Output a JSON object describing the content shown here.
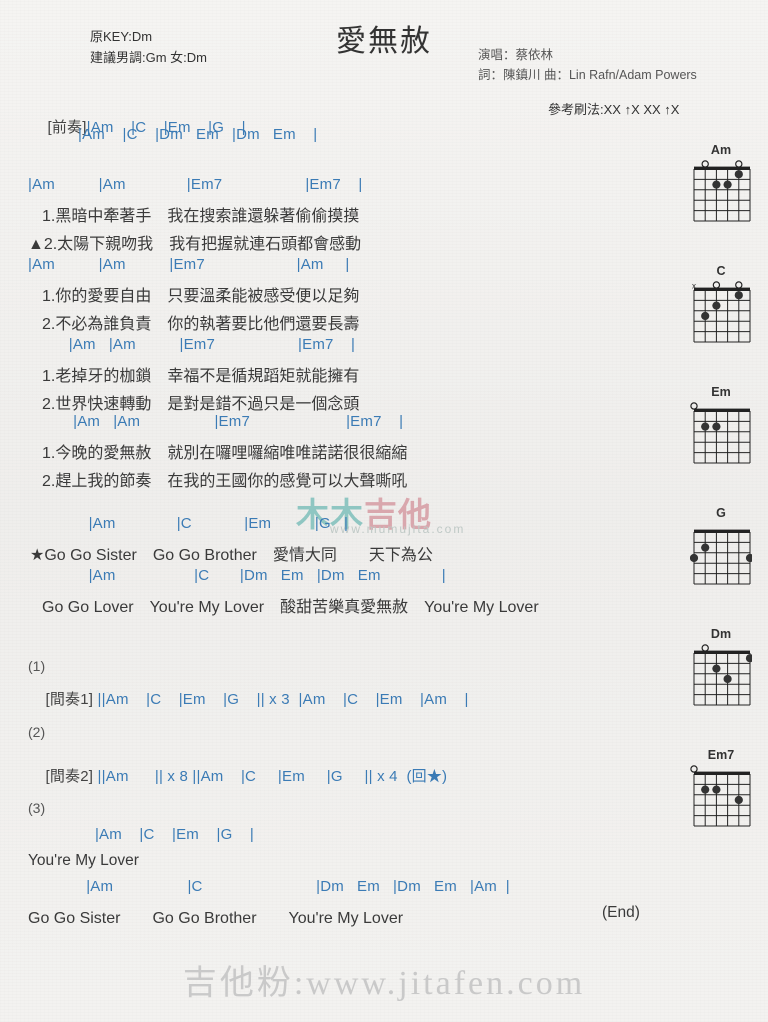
{
  "header": {
    "orig_key": "原KEY:Dm",
    "suggest_key": "建議男調:Gm 女:Dm",
    "title": "愛無赦",
    "singer": "演唱：蔡依林",
    "writers": "詞：陳鎮川  曲：Lin Rafn/Adam Powers",
    "strum": "參考刷法:XX ↑X XX ↑X"
  },
  "intro": {
    "label": "[前奏]",
    "row1": "|Am    |C    |Em    |G    |",
    "row2": "|Am    |C    |Dm   Em   |Dm   Em    |"
  },
  "sections": [
    {
      "name": "verse-1",
      "chords": "|Am          |Am              |Em7                   |Em7    |",
      "lyrics": [
        "1.黑暗中牽著手　我在搜索誰還躲著偷偷摸摸",
        "▲2.太陽下親吻我　我有把握就連石頭都會感動"
      ]
    },
    {
      "name": "verse-2",
      "chords": "|Am          |Am          |Em7                     |Am     |",
      "lyrics": [
        "1.你的愛要自由　只要溫柔能被感受便以足夠",
        "2.不必為誰負責　你的執著要比他們還要長壽"
      ]
    },
    {
      "name": "verse-3",
      "chords": "  |Am   |Am          |Em7                   |Em7    |",
      "lyrics": [
        "1.老掉牙的枷鎖　幸福不是循規蹈矩就能擁有",
        "2.世界快速轉動　是對是錯不過只是一個念頭"
      ]
    },
    {
      "name": "verse-4",
      "chords": "   |Am   |Am                 |Em7                      |Em7    |",
      "lyrics": [
        "1.今晚的愛無赦　就別在囉哩囉縮唯唯諾諾很很縮縮",
        "2.趕上我的節奏　在我的王國你的感覺可以大聲嘶吼"
      ]
    }
  ],
  "chorus": [
    {
      "name": "chorus-line-1",
      "chords": "       |Am              |C            |Em          |G   |",
      "lyric": "★Go Go Sister　Go Go Brother　愛情大同　　天下為公"
    },
    {
      "name": "chorus-line-2",
      "chords": "       |Am                  |C       |Dm   Em   |Dm   Em              |",
      "lyric": "Go Go Lover　You're My Lover　酸甜苦樂真愛無赦　You're My Lover"
    }
  ],
  "interludes": [
    {
      "num": "(1)",
      "label": "[間奏1]",
      "chords": "||Am    |C    |Em    |G    || x 3  |Am    |C    |Em    |Am    |"
    },
    {
      "num": "(2)",
      "label": "[間奏2]",
      "chords": "||Am      || x 8 ||Am    |C     |Em     |G     || x 4  (回★)"
    }
  ],
  "ending": {
    "num": "(3)",
    "line1_chords": "        |Am    |C    |Em    |G    |",
    "line1_lyric": "You're My Lover",
    "line2_chords": "      |Am                 |C                          |Dm   Em   |Dm   Em   |Am  |",
    "line2_lyric": "Go Go Sister　　Go Go Brother　　You're My Lover",
    "end_mark": "(End)"
  },
  "chord_diagrams": [
    {
      "name": "Am",
      "markers": [
        "",
        "o",
        "",
        "",
        "o",
        ""
      ],
      "dots": [
        {
          "s": 2,
          "f": 2
        },
        {
          "s": 3,
          "f": 2
        },
        {
          "s": 4,
          "f": 1
        }
      ]
    },
    {
      "name": "C",
      "markers": [
        "x",
        "",
        "o",
        "",
        "o",
        ""
      ],
      "dots": [
        {
          "s": 1,
          "f": 3
        },
        {
          "s": 2,
          "f": 2
        },
        {
          "s": 4,
          "f": 1
        }
      ]
    },
    {
      "name": "Em",
      "markers": [
        "o",
        "",
        "",
        "",
        "",
        ""
      ],
      "dots": [
        {
          "s": 1,
          "f": 2
        },
        {
          "s": 2,
          "f": 2
        }
      ]
    },
    {
      "name": "G",
      "markers": [
        "",
        "",
        "",
        "",
        "",
        ""
      ],
      "dots": [
        {
          "s": 0,
          "f": 3
        },
        {
          "s": 1,
          "f": 2
        },
        {
          "s": 5,
          "f": 3
        }
      ]
    },
    {
      "name": "Dm",
      "markers": [
        "",
        "o",
        "",
        "",
        "",
        ""
      ],
      "dots": [
        {
          "s": 2,
          "f": 2
        },
        {
          "s": 3,
          "f": 3
        },
        {
          "s": 5,
          "f": 1
        }
      ]
    },
    {
      "name": "Em7",
      "markers": [
        "o",
        "",
        "",
        "",
        "",
        ""
      ],
      "dots": [
        {
          "s": 1,
          "f": 2
        },
        {
          "s": 2,
          "f": 2
        },
        {
          "s": 4,
          "f": 3
        }
      ]
    }
  ],
  "watermarks": {
    "center_a": "木木",
    "center_b": "吉他",
    "center_sub": "www.mumujita.com",
    "bottom": "吉他粉:www.jitafen.com"
  }
}
